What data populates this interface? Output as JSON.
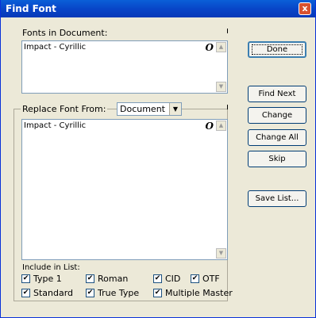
{
  "window": {
    "title": "Find Font",
    "close_glyph": "x"
  },
  "fonts_in_document": {
    "label": "Fonts in Document:",
    "items": [
      {
        "name": "Impact - Cyrillic",
        "type_glyph": "O"
      }
    ]
  },
  "replace_from": {
    "label": "Replace Font From:",
    "selected": "Document",
    "items": [
      {
        "name": "Impact - Cyrillic",
        "type_glyph": "O"
      }
    ]
  },
  "buttons": {
    "done": "Done",
    "find_next": "Find Next",
    "change": "Change",
    "change_all": "Change All",
    "skip": "Skip",
    "save_list": "Save List..."
  },
  "include_in_list": {
    "label": "Include in List:",
    "options": [
      {
        "label": "Type 1",
        "checked": true
      },
      {
        "label": "Roman",
        "checked": true
      },
      {
        "label": "CID",
        "checked": true
      },
      {
        "label": "OTF",
        "checked": true
      },
      {
        "label": "Standard",
        "checked": true
      },
      {
        "label": "True Type",
        "checked": true
      },
      {
        "label": "Multiple Master",
        "checked": true
      }
    ]
  },
  "check_glyph": "✔"
}
